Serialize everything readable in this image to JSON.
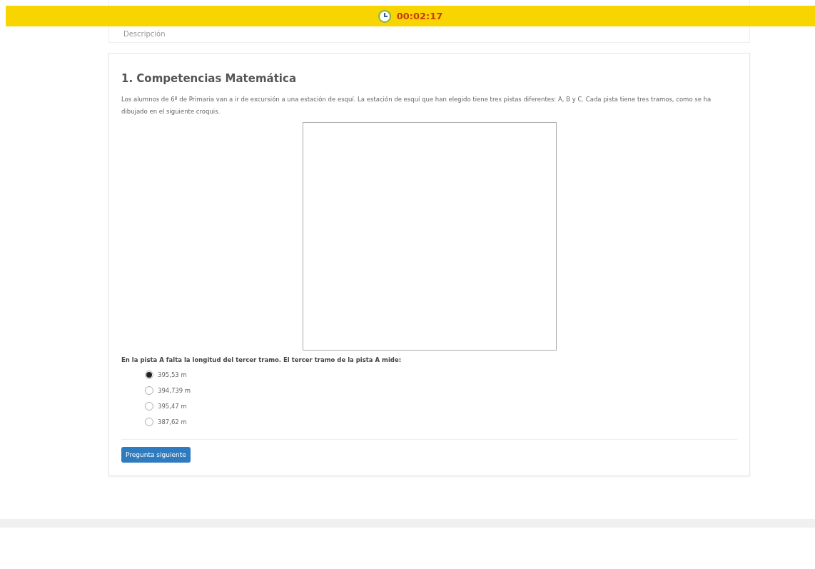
{
  "timer": {
    "time": "00:02:17"
  },
  "description_toggle": {
    "label": "Descripción"
  },
  "question": {
    "title": "1. Competencias Matemática",
    "statement": "Los alumnos de 6º de Primaria van a ir de excursión a una estación de esquí. La estación de esquí que han elegido tiene tres pistas diferentes: A, B y C. Cada pista tiene tres tramos, como se ha dibujado en el siguiente croquis.",
    "prompt": "En la pista A falta la longitud del tercer tramo. El tercer tramo de la pista A mide:",
    "options": [
      {
        "label": "395,53 m",
        "selected": true
      },
      {
        "label": "394,739 m",
        "selected": false
      },
      {
        "label": "395,47 m",
        "selected": false
      },
      {
        "label": "387,62 m",
        "selected": false
      }
    ]
  },
  "next_button": {
    "label": "Pregunta siguiente"
  }
}
